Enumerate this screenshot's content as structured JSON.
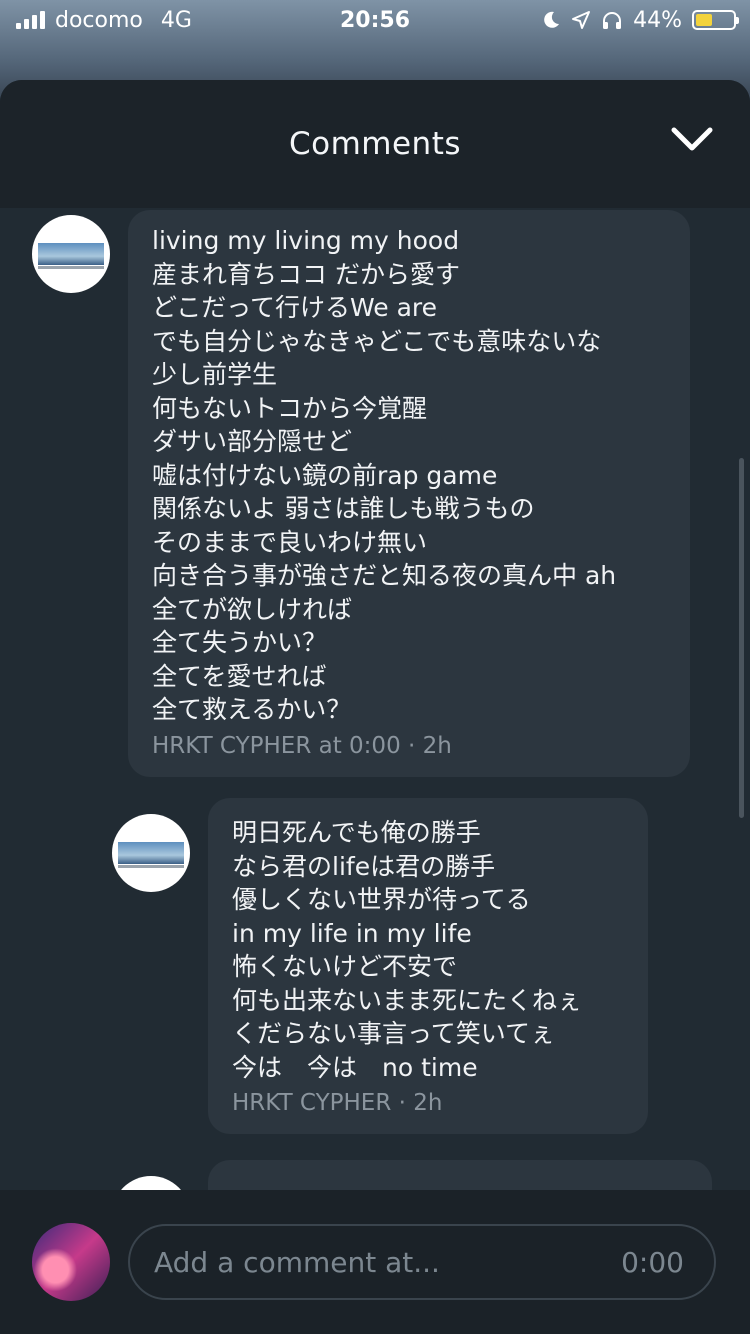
{
  "status_bar": {
    "carrier": "docomo",
    "network": "4G",
    "time": "20:56",
    "battery": "44%",
    "battery_level": 0.44
  },
  "header": {
    "title": "Comments"
  },
  "comments": [
    {
      "lines": [
        "living my living my hood",
        "産まれ育ちココ だから愛す",
        "どこだって行けるWe are",
        "でも自分じゃなきゃどこでも意味ないな",
        "少し前学生",
        "何もないトコから今覚醒",
        "ダサい部分隠せど",
        "嘘は付けない鏡の前rap game",
        "関係ないよ 弱さは誰しも戦うもの",
        "そのままで良いわけ無い",
        "向き合う事が強さだと知る夜の真ん中 ah",
        "全てが欲しければ",
        "全て失うかい？",
        "全てを愛せれば",
        "全て救えるかい？"
      ],
      "meta": "HRKT CYPHER at 0:00 · 2h"
    },
    {
      "lines": [
        "明日死んでも俺の勝手",
        "なら君のlifeは君の勝手",
        "優しくない世界が待ってる",
        "in my life in my life",
        "怖くないけど不安で",
        "何も出来ないまま死にたくねぇ",
        "くだらない事言って笑いてぇ",
        "今は　今は　no time"
      ],
      "meta": "HRKT CYPHER  · 2h"
    }
  ],
  "composer": {
    "placeholder": "Add a comment at...",
    "timestamp": "0:00"
  }
}
